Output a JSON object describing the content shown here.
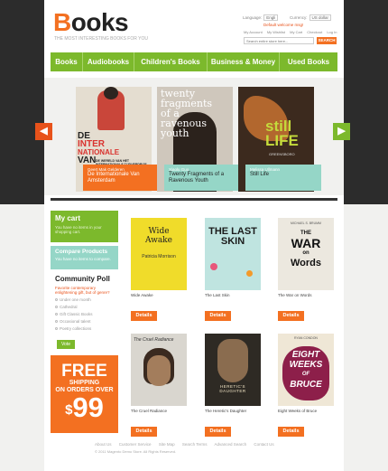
{
  "header": {
    "logo_first": "B",
    "logo_rest": "ooks",
    "tagline": "THE MOST INTERESTING BOOKS FOR YOU",
    "language_label": "Language:",
    "language_value": "Engli",
    "currency_label": "Currency:",
    "currency_value": "US dollar",
    "cart_note": "Default welcome msg!",
    "top_links": [
      "My Account",
      "My Wishlist",
      "My Cart",
      "Checkout",
      "Log In"
    ],
    "search_placeholder": "Search entire store here...",
    "search_button": "SEARCH"
  },
  "nav": {
    "items": [
      {
        "label": "Books"
      },
      {
        "label": "Audiobooks"
      },
      {
        "label": "Children's Books"
      },
      {
        "label": "Business & Money"
      },
      {
        "label": "Used Books"
      }
    ]
  },
  "slider": {
    "prev_arrow": "◀",
    "next_arrow": "▶",
    "slides": [
      {
        "cover_l1": "DE",
        "cover_l2": "INTER",
        "cover_l3": "NATIONALE",
        "cover_l4": "VAN",
        "cover_sub": "DE WERELD VAN HET INTERNATIONALE TIJDVERDRIJF",
        "author": "Geert Mak Gelderen",
        "title": "De Internationale Van Amsterdam"
      },
      {
        "cover_l1": "twenty",
        "cover_l2": "fragments",
        "cover_l3": "of a",
        "cover_l4": "ravenous",
        "cover_l5": "youth",
        "author": "Xiaolu Guo",
        "title": "Twenty Fragments of a Ravenous Youth"
      },
      {
        "cover_l1": "still",
        "cover_l2": "LIFE",
        "cover_sub": "GREENSBORO",
        "author": "Melissa Ullmann",
        "title": "Still Life"
      }
    ]
  },
  "sidebar": {
    "cart_title": "My cart",
    "cart_text": "You have no items in your shopping cart.",
    "compare_title": "Compare Products",
    "compare_text": "You have no items to compare.",
    "poll_title": "Community Poll",
    "poll_question": "Favorite contemporary enlightening gift, but of genre?",
    "poll_options": [
      "Under one month",
      "Cathedral",
      "Gift Classic Books",
      "Occasional talent",
      "Poetry collections"
    ],
    "vote_button": "Vote",
    "promo_free": "FREE",
    "promo_ship1": "SHIPPING",
    "promo_ship2": "ON ORDERS OVER",
    "promo_currency": "$",
    "promo_amount": "99"
  },
  "products": [
    {
      "name": "Wide Awake",
      "details": "Details",
      "cover_title": "Wide Awake",
      "cover_author": "Patricia Morrison"
    },
    {
      "name": "The Last Skin",
      "details": "Details",
      "cover_title": "THE LAST SKIN",
      "cover_author": ""
    },
    {
      "name": "The War on Words",
      "details": "Details",
      "cover_top": "MICHAEL S. BRUMM",
      "cover_title1": "THE",
      "cover_title2": "WAR",
      "cover_title3": "on",
      "cover_title4": "Words"
    },
    {
      "name": "The Cruel Radiance",
      "details": "Details",
      "cover_title": "The Cruel Radiance"
    },
    {
      "name": "The Heretic's Daughter",
      "details": "Details",
      "cover_title": "HERETIC'S DAUGHTER"
    },
    {
      "name": "Eight Weeks of Bruce",
      "details": "Details",
      "cover_top": "RYAN CONDON",
      "cover_title1": "EIGHT",
      "cover_title2": "WEEKS",
      "cover_title3": "OF",
      "cover_title4": "BRUCE"
    }
  ],
  "footer": {
    "links": [
      "About Us",
      "Customer Service",
      "Site Map",
      "Search Terms",
      "Advanced Search",
      "Contact Us"
    ],
    "copyright": "© 2011 Magento Demo Store. All Rights Reserved."
  },
  "colors": {
    "accent_orange": "#f37021",
    "accent_green": "#7cb92c",
    "accent_teal": "#95d6c7",
    "dark_bg": "#2c2c2c"
  }
}
